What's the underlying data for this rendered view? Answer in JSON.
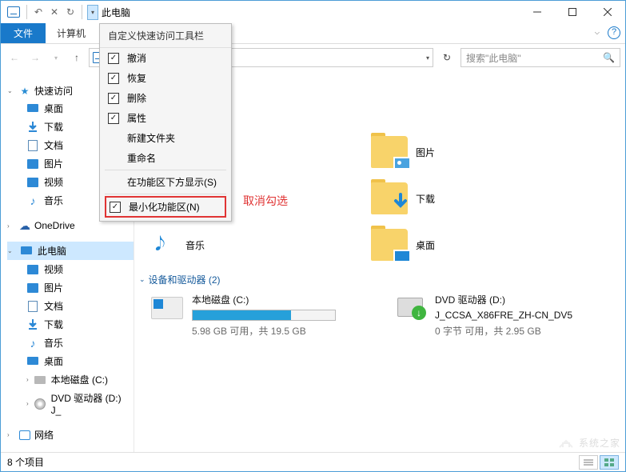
{
  "title": "此电脑",
  "ribbon": {
    "file": "文件",
    "tab_computer": "计算机"
  },
  "address": {
    "text": "",
    "dropdown": "▾"
  },
  "search": {
    "placeholder": "搜索\"此电脑\""
  },
  "sidebar": {
    "quick": "快速访问",
    "items_quick": [
      "桌面",
      "下载",
      "文档",
      "图片",
      "视频",
      "音乐"
    ],
    "onedrive": "OneDrive",
    "thispc": "此电脑",
    "items_pc": [
      "视频",
      "图片",
      "文档",
      "下载",
      "音乐",
      "桌面",
      "本地磁盘 (C:)",
      "DVD 驱动器 (D:) J_"
    ],
    "network": "网络"
  },
  "main": {
    "sect_devices": "设备和驱动器 (2)",
    "music_label": "音乐",
    "folders": [
      "图片",
      "下载",
      "桌面"
    ],
    "drive_c": {
      "name": "本地磁盘 (C:)",
      "sub": "5.98 GB 可用，共 19.5 GB",
      "pct": 69
    },
    "drive_d": {
      "name": "DVD 驱动器 (D:)",
      "sub2": "J_CCSA_X86FRE_ZH-CN_DV5",
      "sub": "0 字节 可用，共 2.95 GB"
    }
  },
  "dropdown": {
    "title": "自定义快速访问工具栏",
    "items": [
      {
        "label": "撤消",
        "checked": true
      },
      {
        "label": "恢复",
        "checked": true
      },
      {
        "label": "删除",
        "checked": true
      },
      {
        "label": "属性",
        "checked": true
      },
      {
        "label": "新建文件夹",
        "checked": false
      },
      {
        "label": "重命名",
        "checked": false
      }
    ],
    "below": "在功能区下方显示(S)",
    "minimize": "最小化功能区(N)",
    "min_checked": true
  },
  "annotation": "取消勾选",
  "status": "8 个项目",
  "watermark": "系统之家"
}
